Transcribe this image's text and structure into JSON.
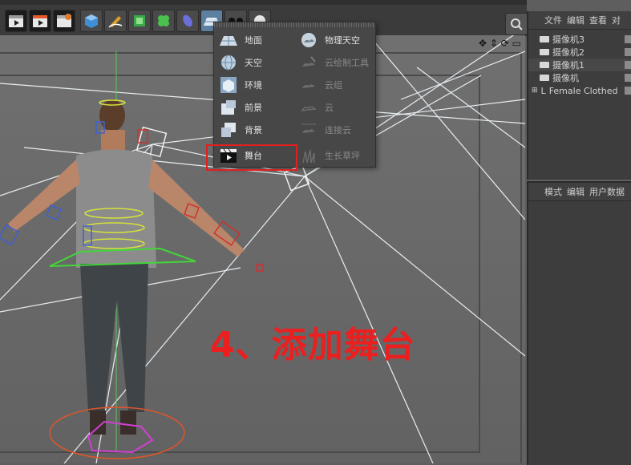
{
  "popup": {
    "left_items": [
      {
        "label": "地面",
        "icon": "floor-icon"
      },
      {
        "label": "天空",
        "icon": "sky-icon"
      },
      {
        "label": "环境",
        "icon": "environment-icon"
      },
      {
        "label": "前景",
        "icon": "foreground-icon"
      },
      {
        "label": "背景",
        "icon": "background-icon"
      },
      {
        "label": "舞台",
        "icon": "stage-icon"
      }
    ],
    "right_items": [
      {
        "label": "物理天空",
        "icon": "physical-sky-icon"
      },
      {
        "label": "云绘制工具",
        "icon": "cloud-paint-icon"
      },
      {
        "label": "云组",
        "icon": "cloud-group-icon"
      },
      {
        "label": "云",
        "icon": "cloud-icon"
      },
      {
        "label": "连接云",
        "icon": "connect-cloud-icon"
      },
      {
        "label": "生长草坪",
        "icon": "grass-icon"
      }
    ]
  },
  "object_manager": {
    "menu": [
      "文件",
      "编辑",
      "查看",
      "对"
    ],
    "items": [
      "摄像机3",
      "摄像机2",
      "摄像机1",
      "摄像机",
      "Female Clothed"
    ]
  },
  "attribute_manager": {
    "menu": [
      "模式",
      "编辑",
      "用户数据"
    ]
  },
  "annotation": "4、添加舞台",
  "colors": {
    "accent_red": "#e02020",
    "viewport_bg": "#6a6a6a",
    "panel_bg": "#3d3d3d"
  }
}
